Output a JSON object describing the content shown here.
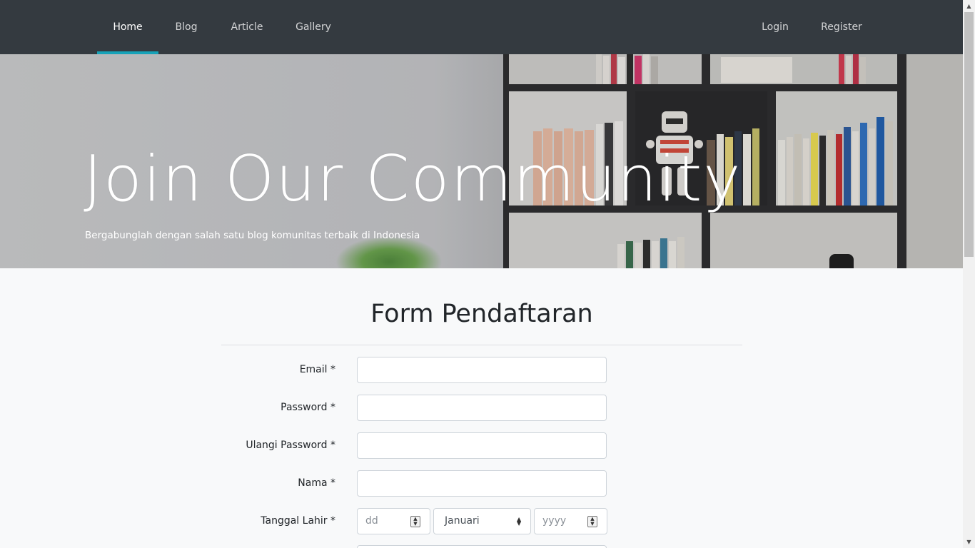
{
  "nav": {
    "items": [
      {
        "label": "Home",
        "active": true
      },
      {
        "label": "Blog",
        "active": false
      },
      {
        "label": "Article",
        "active": false
      },
      {
        "label": "Gallery",
        "active": false
      }
    ],
    "login": "Login",
    "register": "Register",
    "accent_color": "#17a2b8",
    "background_color": "#343a40"
  },
  "hero": {
    "title": "Join Our Community",
    "subtitle": "Bergabunglah dengan salah satu blog komunitas terbaik di Indonesia"
  },
  "form": {
    "title": "Form Pendaftaran",
    "fields": [
      {
        "label": "Email *",
        "value": ""
      },
      {
        "label": "Password *",
        "value": ""
      },
      {
        "label": "Ulangi Password *",
        "value": ""
      },
      {
        "label": "Nama *",
        "value": ""
      }
    ],
    "birth_date": {
      "label": "Tanggal Lahir *",
      "day_placeholder": "dd",
      "month_selected": "Januari",
      "year_placeholder": "yyyy"
    }
  }
}
